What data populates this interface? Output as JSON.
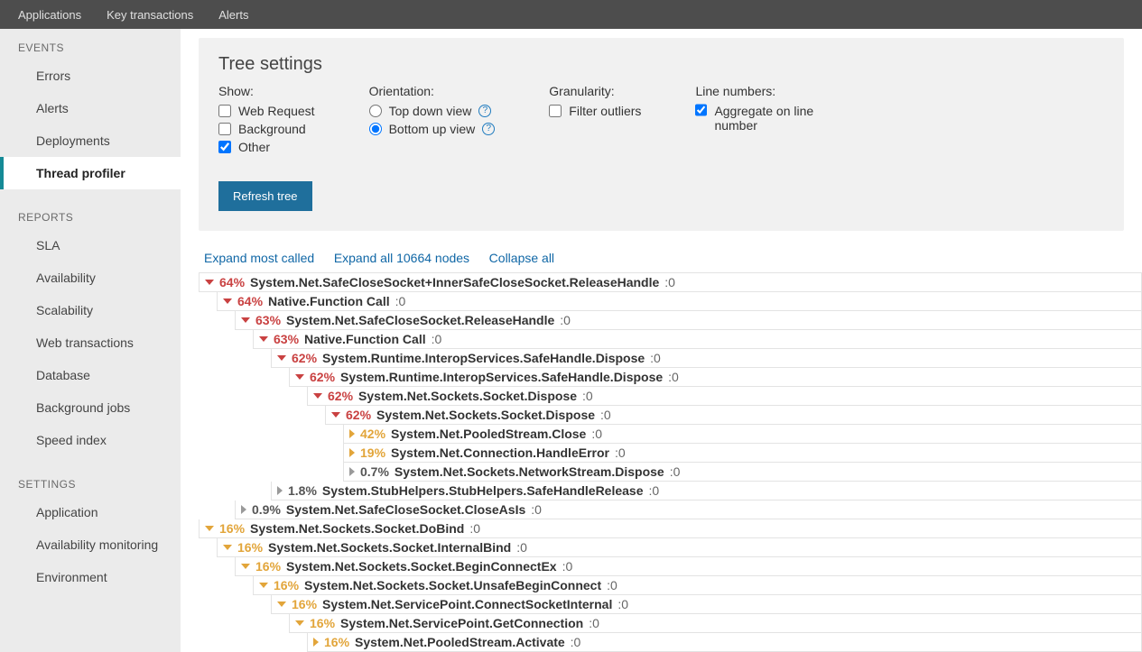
{
  "top_nav": {
    "applications": "Applications",
    "key_transactions": "Key transactions",
    "alerts": "Alerts"
  },
  "sidebar": {
    "events": {
      "header": "EVENTS",
      "errors": "Errors",
      "alerts": "Alerts",
      "deployments": "Deployments",
      "thread_profiler": "Thread profiler"
    },
    "reports": {
      "header": "REPORTS",
      "sla": "SLA",
      "availability": "Availability",
      "scalability": "Scalability",
      "web_transactions": "Web transactions",
      "database": "Database",
      "background_jobs": "Background jobs",
      "speed_index": "Speed index"
    },
    "settings": {
      "header": "SETTINGS",
      "application": "Application",
      "availability_monitoring": "Availability monitoring",
      "environment": "Environment"
    }
  },
  "settings_panel": {
    "title": "Tree settings",
    "show_label": "Show:",
    "show_web_request": "Web Request",
    "show_background": "Background",
    "show_other": "Other",
    "orientation_label": "Orientation:",
    "top_down": "Top down view",
    "bottom_up": "Bottom up view",
    "granularity_label": "Granularity:",
    "filter_outliers": "Filter outliers",
    "line_numbers_label": "Line numbers:",
    "aggregate": "Aggregate on line number",
    "refresh": "Refresh tree"
  },
  "tree_actions": {
    "expand_most_called": "Expand most called",
    "expand_all": "Expand all 10664 nodes",
    "collapse_all": "Collapse all"
  },
  "rows": [
    {
      "indent": 0,
      "tri": "down",
      "tri_color": "red",
      "pct": "64%",
      "pct_color": "red",
      "fn": "System.Net.SafeCloseSocket+InnerSafeCloseSocket.ReleaseHandle",
      "suffix": ":0"
    },
    {
      "indent": 1,
      "tri": "down",
      "tri_color": "red",
      "pct": "64%",
      "pct_color": "red",
      "fn": "Native.Function Call",
      "suffix": ":0"
    },
    {
      "indent": 2,
      "tri": "down",
      "tri_color": "red",
      "pct": "63%",
      "pct_color": "red",
      "fn": "System.Net.SafeCloseSocket.ReleaseHandle",
      "suffix": ":0"
    },
    {
      "indent": 3,
      "tri": "down",
      "tri_color": "red",
      "pct": "63%",
      "pct_color": "red",
      "fn": "Native.Function Call",
      "suffix": ":0"
    },
    {
      "indent": 4,
      "tri": "down",
      "tri_color": "red",
      "pct": "62%",
      "pct_color": "red",
      "fn": "System.Runtime.InteropServices.SafeHandle.Dispose",
      "suffix": ":0"
    },
    {
      "indent": 5,
      "tri": "down",
      "tri_color": "red",
      "pct": "62%",
      "pct_color": "red",
      "fn": "System.Runtime.InteropServices.SafeHandle.Dispose",
      "suffix": ":0"
    },
    {
      "indent": 6,
      "tri": "down",
      "tri_color": "red",
      "pct": "62%",
      "pct_color": "red",
      "fn": "System.Net.Sockets.Socket.Dispose",
      "suffix": ":0"
    },
    {
      "indent": 7,
      "tri": "down",
      "tri_color": "red",
      "pct": "62%",
      "pct_color": "red",
      "fn": "System.Net.Sockets.Socket.Dispose",
      "suffix": ":0"
    },
    {
      "indent": 8,
      "tri": "right",
      "tri_color": "orange",
      "pct": "42%",
      "pct_color": "orange",
      "fn": "System.Net.PooledStream.Close",
      "suffix": ":0"
    },
    {
      "indent": 8,
      "tri": "right",
      "tri_color": "orange",
      "pct": "19%",
      "pct_color": "orange",
      "fn": "System.Net.Connection.HandleError",
      "suffix": ":0"
    },
    {
      "indent": 8,
      "tri": "right",
      "tri_color": "gray",
      "pct": "0.7%",
      "pct_color": "gray",
      "fn": "System.Net.Sockets.NetworkStream.Dispose",
      "suffix": ":0"
    },
    {
      "indent": 4,
      "tri": "right",
      "tri_color": "gray",
      "pct": "1.8%",
      "pct_color": "gray",
      "fn": "System.StubHelpers.StubHelpers.SafeHandleRelease",
      "suffix": ":0"
    },
    {
      "indent": 2,
      "tri": "right",
      "tri_color": "gray",
      "pct": "0.9%",
      "pct_color": "gray",
      "fn": "System.Net.SafeCloseSocket.CloseAsIs",
      "suffix": ":0"
    },
    {
      "indent": 0,
      "tri": "down",
      "tri_color": "orange",
      "pct": "16%",
      "pct_color": "orange",
      "fn": "System.Net.Sockets.Socket.DoBind",
      "suffix": ":0"
    },
    {
      "indent": 1,
      "tri": "down",
      "tri_color": "orange",
      "pct": "16%",
      "pct_color": "orange",
      "fn": "System.Net.Sockets.Socket.InternalBind",
      "suffix": ":0"
    },
    {
      "indent": 2,
      "tri": "down",
      "tri_color": "orange",
      "pct": "16%",
      "pct_color": "orange",
      "fn": "System.Net.Sockets.Socket.BeginConnectEx",
      "suffix": ":0"
    },
    {
      "indent": 3,
      "tri": "down",
      "tri_color": "orange",
      "pct": "16%",
      "pct_color": "orange",
      "fn": "System.Net.Sockets.Socket.UnsafeBeginConnect",
      "suffix": ":0"
    },
    {
      "indent": 4,
      "tri": "down",
      "tri_color": "orange",
      "pct": "16%",
      "pct_color": "orange",
      "fn": "System.Net.ServicePoint.ConnectSocketInternal",
      "suffix": ":0"
    },
    {
      "indent": 5,
      "tri": "down",
      "tri_color": "orange",
      "pct": "16%",
      "pct_color": "orange",
      "fn": "System.Net.ServicePoint.GetConnection",
      "suffix": ":0"
    },
    {
      "indent": 6,
      "tri": "right",
      "tri_color": "orange",
      "pct": "16%",
      "pct_color": "orange",
      "fn": "System.Net.PooledStream.Activate",
      "suffix": ":0"
    }
  ]
}
